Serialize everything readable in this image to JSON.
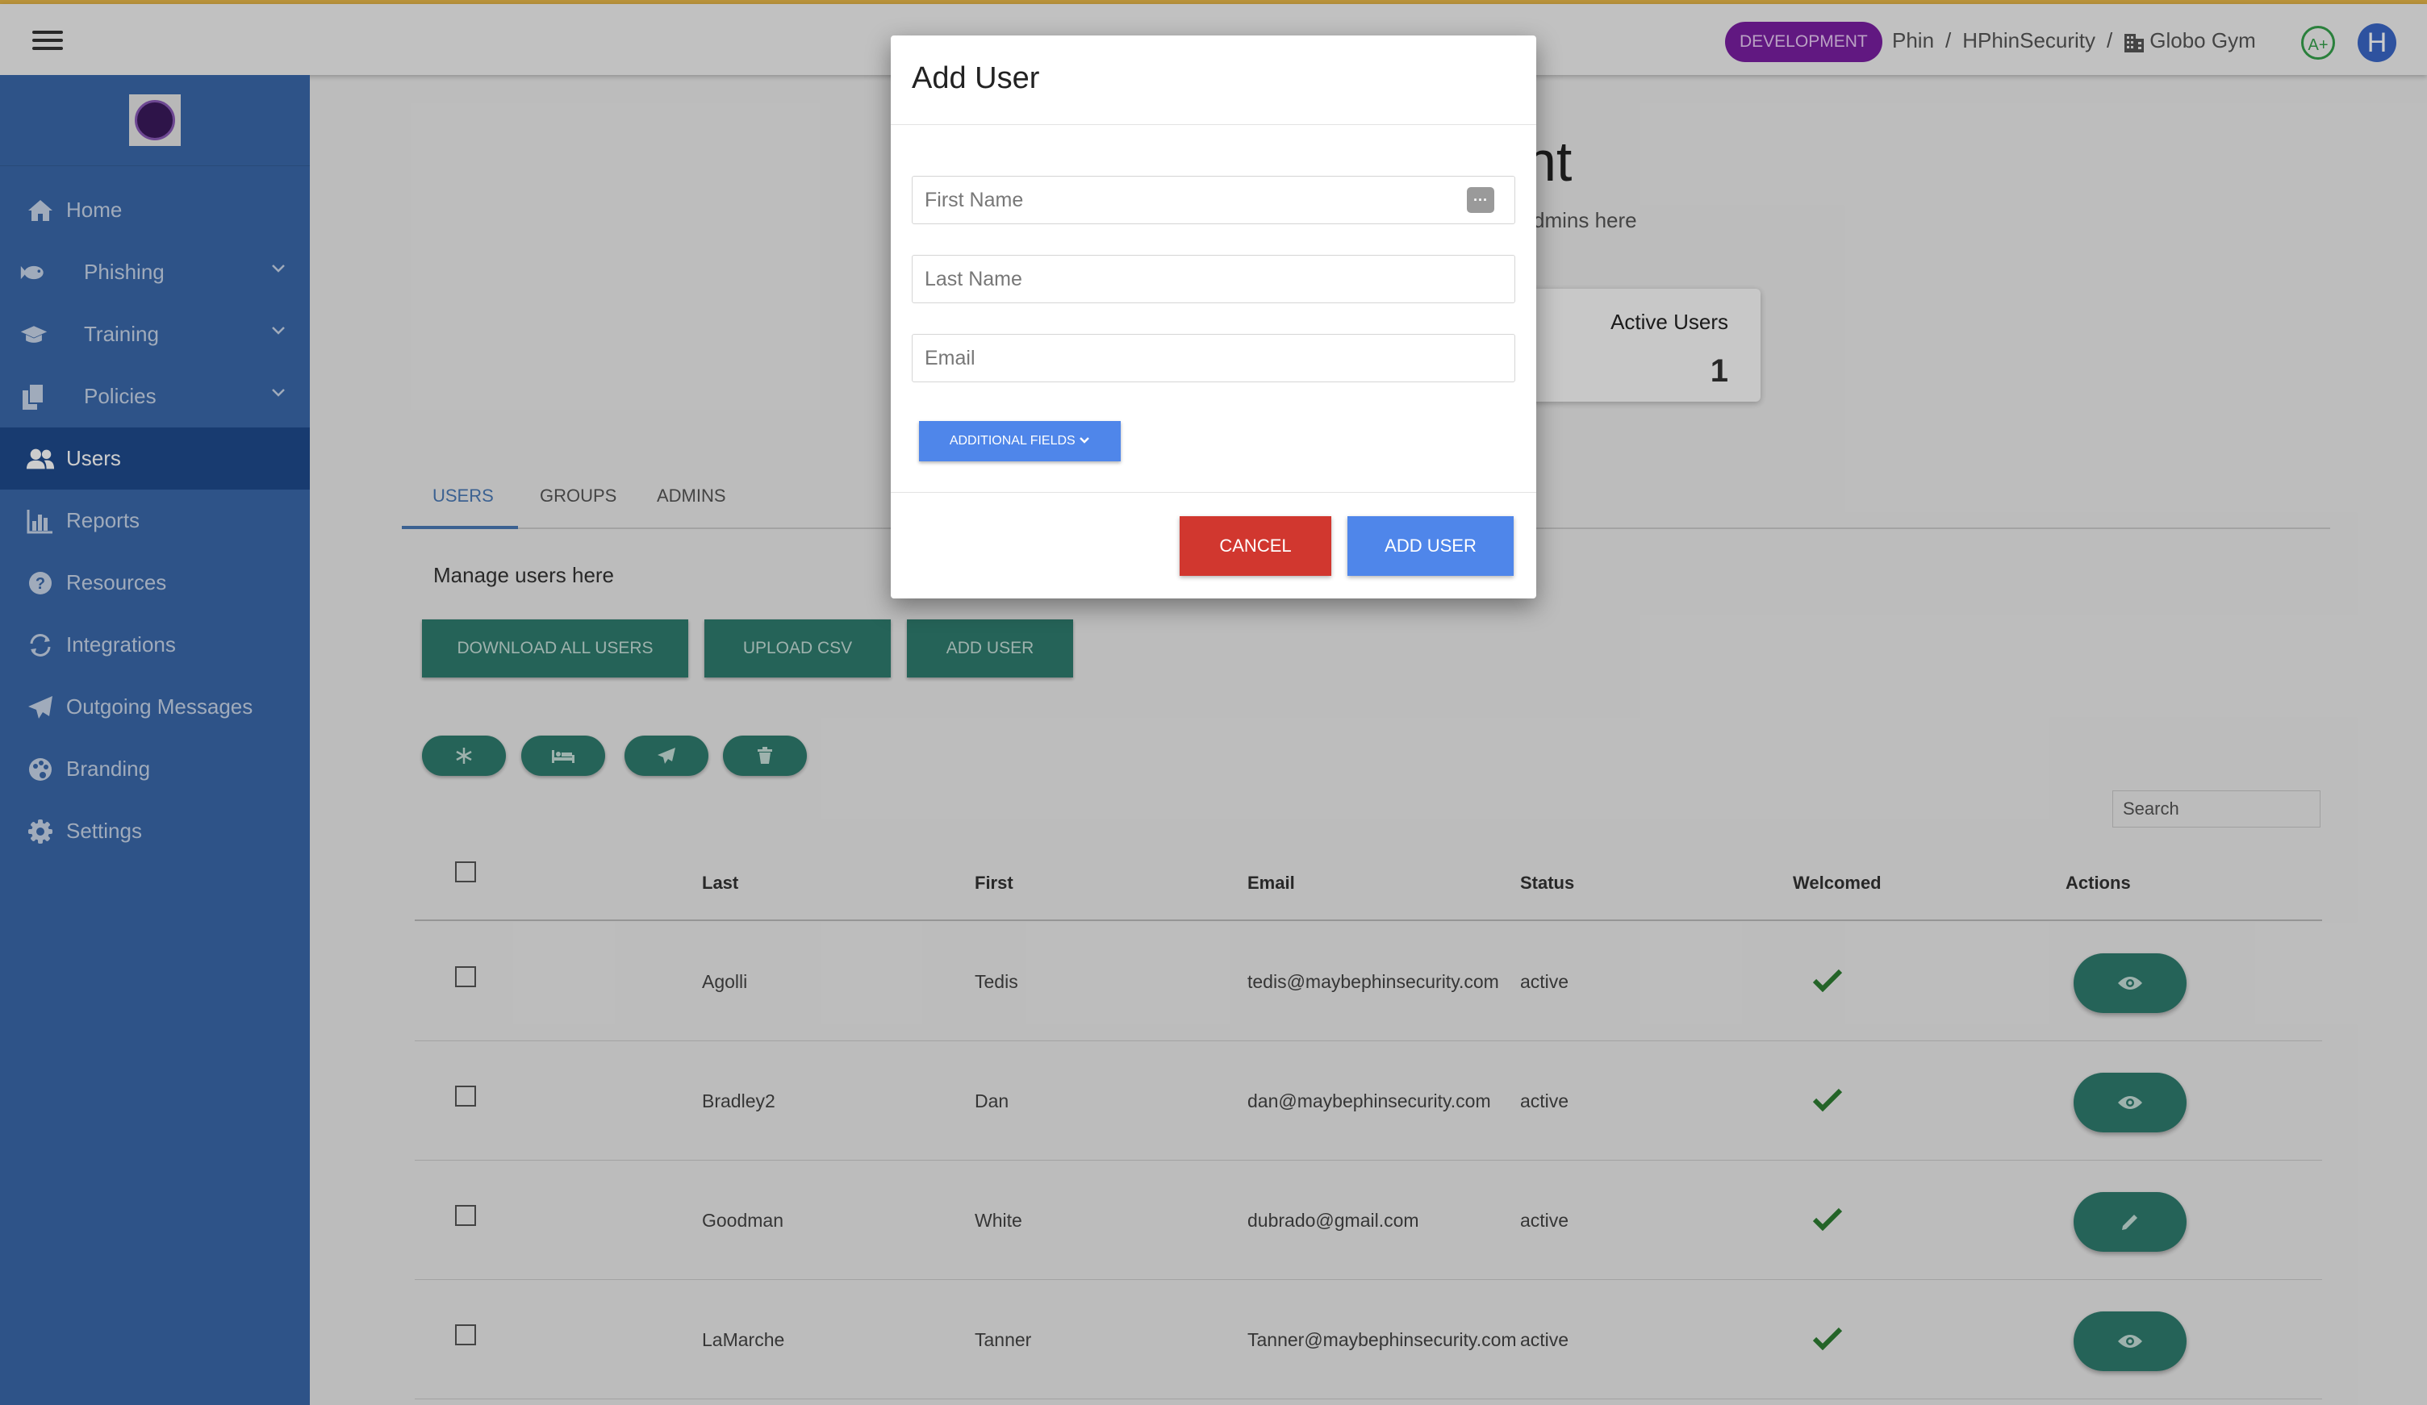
{
  "topbar": {
    "environment_badge": "DEVELOPMENT",
    "breadcrumbs": [
      "Phin",
      "HPhinSecurity",
      "Globo Gym"
    ],
    "breadcrumb_separator": "/",
    "grade_badge": "A+",
    "avatar_initial": "H"
  },
  "sidebar": {
    "items": [
      {
        "label": "Home",
        "icon": "home-icon"
      },
      {
        "label": "Phishing",
        "icon": "fish-icon",
        "expandable": true
      },
      {
        "label": "Training",
        "icon": "graduation-cap-icon",
        "expandable": true
      },
      {
        "label": "Policies",
        "icon": "documents-icon",
        "expandable": true
      },
      {
        "label": "Users",
        "icon": "users-icon",
        "active": true
      },
      {
        "label": "Reports",
        "icon": "bar-chart-icon"
      },
      {
        "label": "Resources",
        "icon": "question-circle-icon"
      },
      {
        "label": "Integrations",
        "icon": "sync-icon"
      },
      {
        "label": "Outgoing Messages",
        "icon": "paper-plane-icon"
      },
      {
        "label": "Branding",
        "icon": "palette-icon"
      },
      {
        "label": "Settings",
        "icon": "gear-icon"
      }
    ]
  },
  "main": {
    "title_fragment": "nt",
    "subtitle_fragment": "dmins here",
    "stat_card": {
      "label": "Active Users",
      "value": "1"
    },
    "tabs": [
      {
        "label": "USERS",
        "active": true
      },
      {
        "label": "GROUPS"
      },
      {
        "label": "ADMINS"
      }
    ],
    "manage_text": "Manage users here",
    "action_buttons": {
      "download_all": "DOWNLOAD ALL USERS",
      "upload_csv": "UPLOAD CSV",
      "add_user": "ADD USER"
    },
    "bulk_icons": [
      "snowflake-icon",
      "bed-icon",
      "paper-plane-icon",
      "trash-icon"
    ],
    "search_placeholder": "Search",
    "table": {
      "columns": [
        "Last",
        "First",
        "Email",
        "Status",
        "Welcomed",
        "Actions"
      ],
      "rows": [
        {
          "last": "Agolli",
          "first": "Tedis",
          "email": "tedis@maybephinsecurity.com",
          "status": "active",
          "welcomed": true,
          "action_icon": "eye-icon"
        },
        {
          "last": "Bradley2",
          "first": "Dan",
          "email": "dan@maybephinsecurity.com",
          "status": "active",
          "welcomed": true,
          "action_icon": "eye-icon"
        },
        {
          "last": "Goodman",
          "first": "White",
          "email": "dubrado@gmail.com",
          "status": "active",
          "welcomed": true,
          "action_icon": "pencil-icon"
        },
        {
          "last": "LaMarche",
          "first": "Tanner",
          "email": "Tanner@maybephinsecurity.com",
          "status": "active",
          "welcomed": true,
          "action_icon": "eye-icon"
        }
      ]
    }
  },
  "modal": {
    "title": "Add User",
    "first_name_placeholder": "First Name",
    "last_name_placeholder": "Last Name",
    "email_placeholder": "Email",
    "additional_fields_label": "ADDITIONAL FIELDS",
    "cancel_label": "CANCEL",
    "add_user_label": "ADD USER"
  },
  "colors": {
    "sidebar": "#3a68aa",
    "sidebar_active": "#1e4a8c",
    "teal_button": "#2f7c6e",
    "primary_blue": "#4f86ea",
    "danger_red": "#d1372f",
    "dev_badge": "#7a1fa2",
    "check_green": "#2e7d32"
  }
}
